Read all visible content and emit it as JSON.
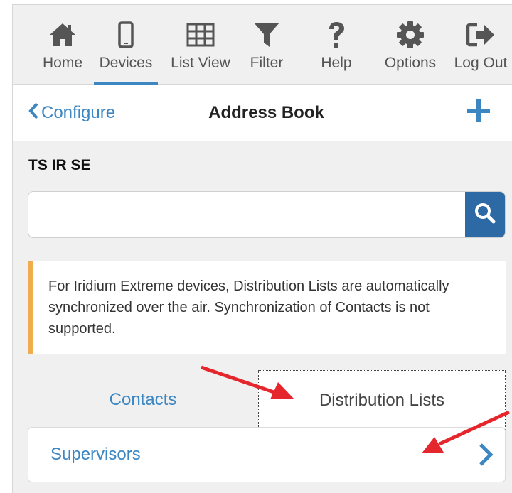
{
  "toolbar": {
    "items": [
      {
        "label": "Home",
        "icon": "home-icon"
      },
      {
        "label": "Devices",
        "icon": "device-icon",
        "active": true
      },
      {
        "label": "List View",
        "icon": "grid-icon"
      },
      {
        "label": "Filter",
        "icon": "filter-icon"
      },
      {
        "label": "Help",
        "icon": "help-icon"
      },
      {
        "label": "Options",
        "icon": "gear-icon"
      },
      {
        "label": "Log Out",
        "icon": "logout-icon"
      }
    ]
  },
  "header": {
    "back_label": "Configure",
    "title": "Address Book",
    "add_icon": "plus-icon"
  },
  "device_name": "TS IR SE",
  "search": {
    "value": "",
    "placeholder": ""
  },
  "notice": {
    "text": "For Iridium Extreme devices, Distribution Lists are automatically synchronized over the air. Synchronization of Contacts is not supported."
  },
  "tabs": [
    {
      "label": "Contacts",
      "active": false
    },
    {
      "label": "Distribution Lists",
      "active": true
    }
  ],
  "list": {
    "items": [
      {
        "label": "Supervisors"
      }
    ]
  },
  "colors": {
    "accent": "#3c86c2",
    "search_button": "#2d6aa5",
    "notice_border": "#f0ad4e",
    "annotation_arrow": "#e5262c"
  }
}
